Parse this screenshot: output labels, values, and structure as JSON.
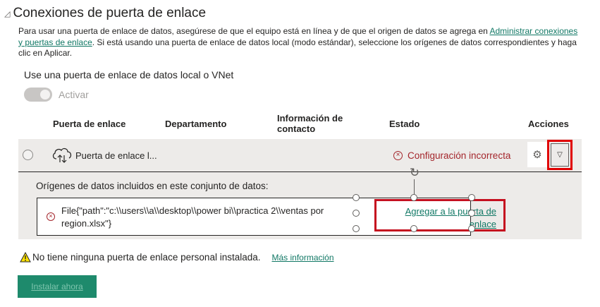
{
  "section": {
    "title": "Conexiones de puerta de enlace"
  },
  "description": {
    "part1": "Para usar una puerta de enlace de datos, asegúrese de que el equipo está en línea y de que el origen de datos se agrega en ",
    "link": "Administrar conexiones y puertas de enlace",
    "part2": ". Si está usando una puerta de enlace de datos local (modo estándar), seleccione los orígenes de datos correspondientes y haga clic en Aplicar."
  },
  "vnet": {
    "label": "Use una puerta de enlace de datos local o VNet",
    "toggle_label": "Activar",
    "toggle_on": true
  },
  "table": {
    "headers": {
      "gateway": "Puerta de enlace",
      "department": "Departamento",
      "contact": "Información de contacto",
      "status": "Estado",
      "actions": "Acciones"
    },
    "row": {
      "gateway_name": "Puerta de enlace l...",
      "status": "Configuración incorrecta",
      "status_color": "#a4262c"
    }
  },
  "detail": {
    "title": "Orígenes de datos incluidos en este conjunto de datos:",
    "source_path": "File{\"path\":\"c:\\\\users\\\\a\\\\desktop\\\\power bi\\\\practica 2\\\\ventas por region.xlsx\"}",
    "add_link": "Agregar a la puerta de enlace"
  },
  "warning": {
    "text": "No tiene ninguna puerta de enlace personal instalada.",
    "link": "Más información"
  },
  "install_button": "Instalar ahora",
  "colors": {
    "accent": "#117865",
    "error": "#a4262c",
    "highlight": "#e00000",
    "button": "#1e8a6c"
  }
}
